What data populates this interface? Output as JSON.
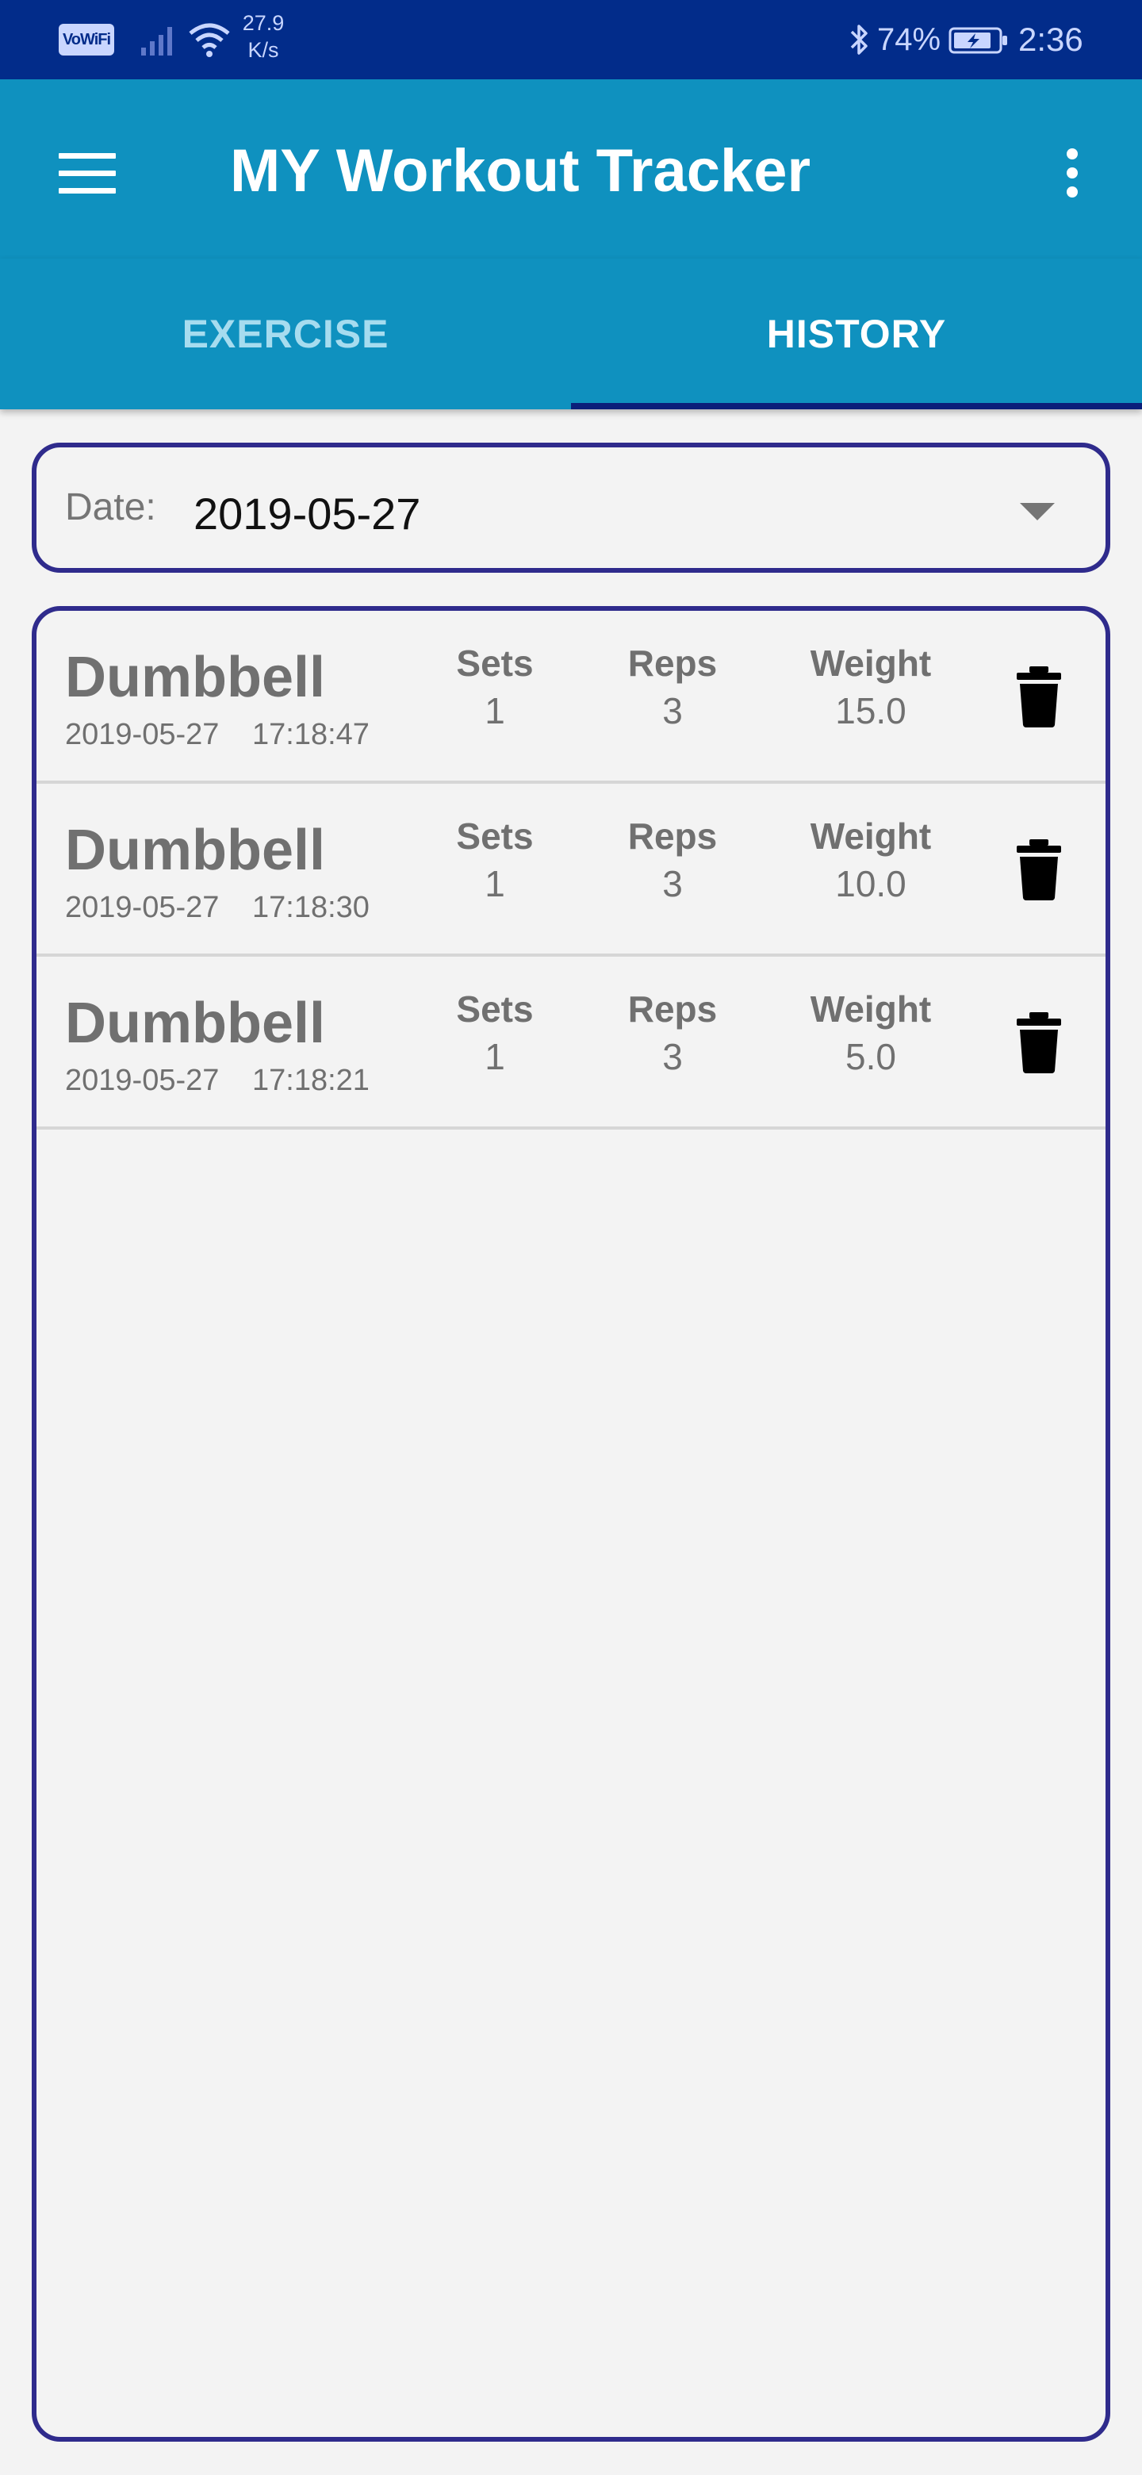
{
  "status_bar": {
    "vowifi": "VoWiFi",
    "speed_value": "27.9",
    "speed_unit": "K/s",
    "battery_pct": "74%",
    "time": "2:36"
  },
  "app_bar": {
    "title": "MY Workout Tracker"
  },
  "tabs": [
    {
      "label": "EXERCISE",
      "selected": false
    },
    {
      "label": "HISTORY",
      "selected": true
    }
  ],
  "date_filter": {
    "label": "Date:",
    "value": "2019-05-27"
  },
  "history": {
    "columns": {
      "sets": "Sets",
      "reps": "Reps",
      "weight": "Weight"
    },
    "entries": [
      {
        "name": "Dumbbell",
        "date": "2019-05-27",
        "time": "17:18:47",
        "sets": "1",
        "reps": "3",
        "weight": "15.0"
      },
      {
        "name": "Dumbbell",
        "date": "2019-05-27",
        "time": "17:18:30",
        "sets": "1",
        "reps": "3",
        "weight": "10.0"
      },
      {
        "name": "Dumbbell",
        "date": "2019-05-27",
        "time": "17:18:21",
        "sets": "1",
        "reps": "3",
        "weight": "5.0"
      }
    ]
  },
  "icons": {
    "menu": "menu-icon",
    "overflow": "more-vert-icon",
    "dropdown": "dropdown-arrow-icon",
    "delete": "trash-icon"
  },
  "colors": {
    "status_bar": "#022c8a",
    "app_bar": "#0f91bf",
    "tab_indicator": "#0b1f7a",
    "border": "#2f2b8c",
    "text_muted": "#707070"
  }
}
